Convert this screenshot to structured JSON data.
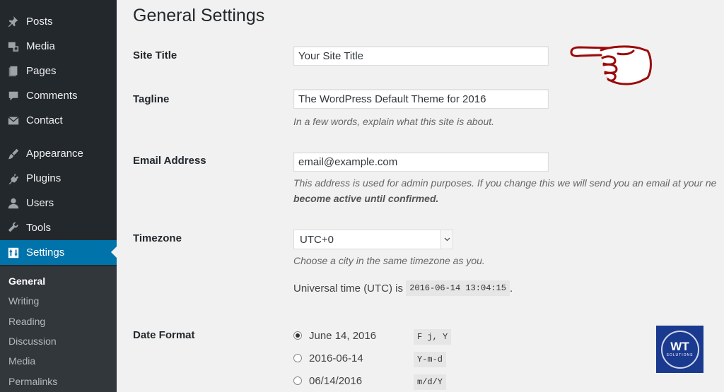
{
  "sidebar": {
    "items": [
      {
        "label": "Posts",
        "icon": "pushpin-icon"
      },
      {
        "label": "Media",
        "icon": "media-icon"
      },
      {
        "label": "Pages",
        "icon": "pages-icon"
      },
      {
        "label": "Comments",
        "icon": "comment-icon"
      },
      {
        "label": "Contact",
        "icon": "envelope-icon"
      },
      {
        "label": "Appearance",
        "icon": "brush-icon"
      },
      {
        "label": "Plugins",
        "icon": "plug-icon"
      },
      {
        "label": "Users",
        "icon": "user-icon"
      },
      {
        "label": "Tools",
        "icon": "wrench-icon"
      },
      {
        "label": "Settings",
        "icon": "settings-icon"
      }
    ],
    "current": "Settings",
    "submenu": [
      "General",
      "Writing",
      "Reading",
      "Discussion",
      "Media",
      "Permalinks"
    ],
    "submenu_current": "General"
  },
  "page": {
    "title": "General Settings"
  },
  "settings": {
    "site_title": {
      "label": "Site Title",
      "value": "Your Site Title"
    },
    "tagline": {
      "label": "Tagline",
      "value": "The WordPress Default Theme for 2016",
      "description": "In a few words, explain what this site is about."
    },
    "email": {
      "label": "Email Address",
      "value": "email@example.com",
      "description": "This address is used for admin purposes. If you change this we will send you an email at your ne",
      "description_strong": "become active until confirmed."
    },
    "timezone": {
      "label": "Timezone",
      "value": "UTC+0",
      "description": "Choose a city in the same timezone as you.",
      "utc_prefix": "Universal time (UTC) is",
      "utc_value": "2016-06-14 13:04:15",
      "utc_suffix": "."
    },
    "date_format": {
      "label": "Date Format",
      "options": [
        {
          "label": "June 14, 2016",
          "code": "F j, Y",
          "checked": true
        },
        {
          "label": "2016-06-14",
          "code": "Y-m-d",
          "checked": false
        },
        {
          "label": "06/14/2016",
          "code": "m/d/Y",
          "checked": false
        }
      ]
    }
  },
  "logo": {
    "text": "WT",
    "subtext": "SOLUTIONS"
  },
  "colors": {
    "sidebar_bg": "#23282d",
    "submenu_bg": "#32373c",
    "accent": "#0073aa",
    "hand_stroke": "#9b0a0a"
  }
}
